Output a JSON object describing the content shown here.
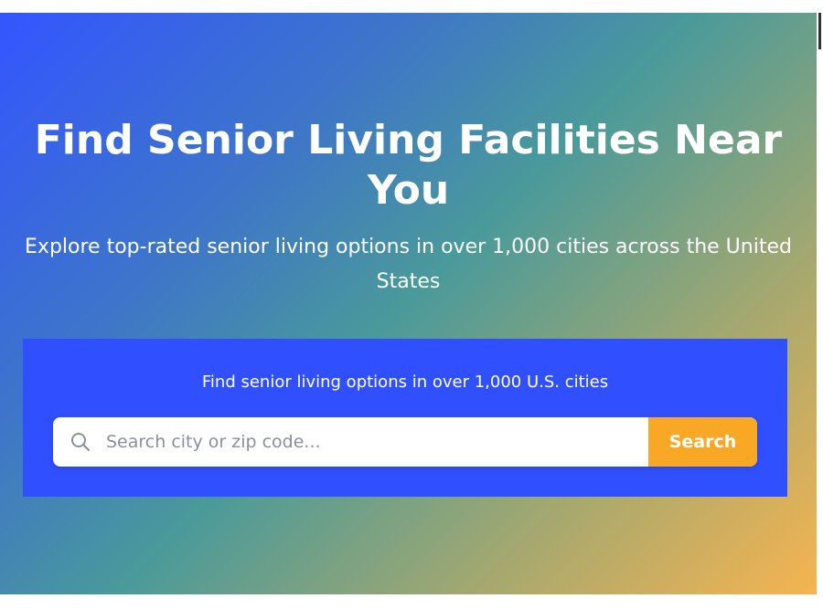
{
  "hero": {
    "title": "Find Senior Living Facilities Near You",
    "subtitle": "Explore top-rated senior living options in over 1,000 cities across the United States",
    "gradient_colors": [
      "#3355ff",
      "#4a9a9a",
      "#f6b450"
    ]
  },
  "search": {
    "caption": "Find senior living options in over 1,000 U.S. cities",
    "placeholder": "Search city or zip code...",
    "value": "",
    "button_label": "Search",
    "icon": "search-icon",
    "panel_color": "#3050ff",
    "button_color": "#f9a825"
  }
}
